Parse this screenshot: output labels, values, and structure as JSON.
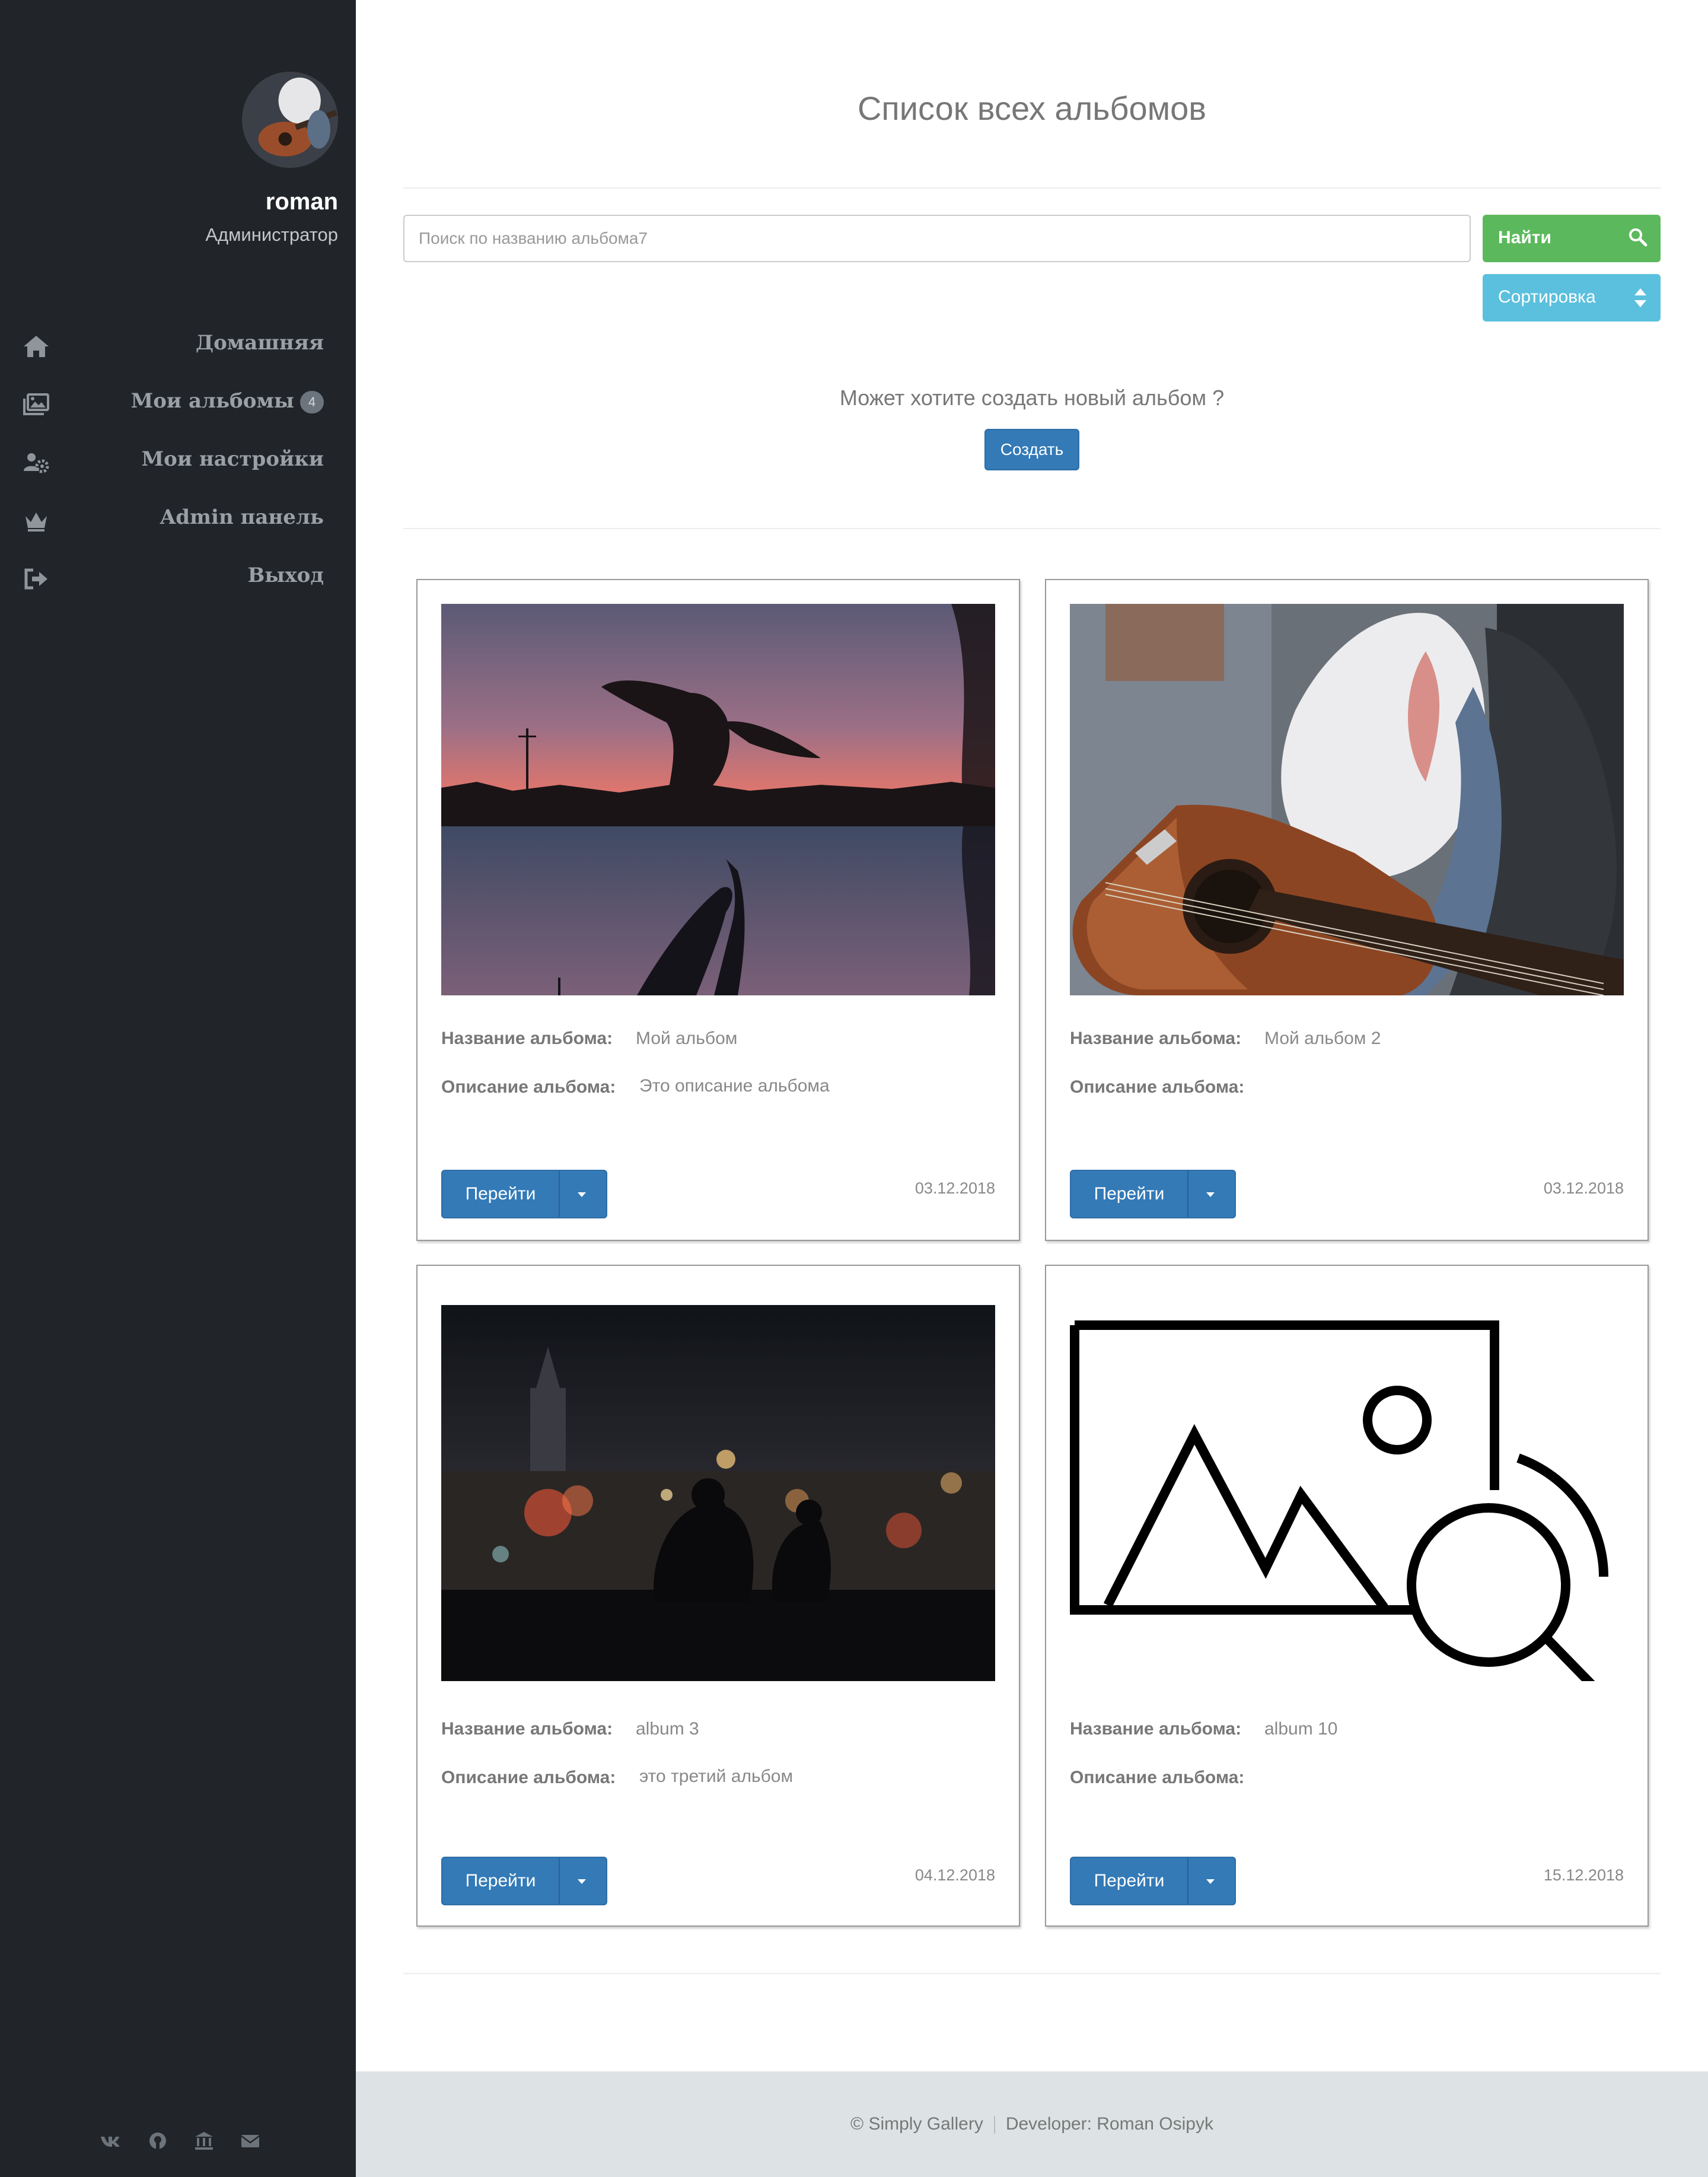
{
  "user": {
    "name": "roman",
    "role": "Администратор"
  },
  "nav": [
    {
      "label": "Домашняя",
      "icon": "home-icon"
    },
    {
      "label": "Мои альбомы",
      "icon": "images-icon",
      "badge": "4"
    },
    {
      "label": "Мои настройки",
      "icon": "users-gear-icon"
    },
    {
      "label": "Admin панель",
      "icon": "crown-icon"
    },
    {
      "label": "Выход",
      "icon": "sign-out-icon"
    }
  ],
  "social": [
    "vk-icon",
    "github-icon",
    "bank-icon",
    "envelope-icon"
  ],
  "page_title": "Список всех альбомов",
  "search": {
    "placeholder": "Поиск по названию альбома7",
    "value": ""
  },
  "find_label": "Найти",
  "sort_label": "Сортировка",
  "create_prompt": "Может хотите создать новый альбом ?",
  "create_label": "Создать",
  "labels": {
    "name": "Название альбома:",
    "desc": "Описание альбома:",
    "go": "Перейти"
  },
  "albums": [
    {
      "name": "Мой альбом",
      "desc": "Это описание альбома",
      "date": "03.12.2018",
      "image": "sunset-silhouette"
    },
    {
      "name": "Мой альбом 2",
      "desc": "",
      "date": "03.12.2018",
      "image": "guitar-shark"
    },
    {
      "name": "album 3",
      "desc": "это третий альбом",
      "date": "04.12.2018",
      "image": "night-city-couple"
    },
    {
      "name": "album 10",
      "desc": "",
      "date": "15.12.2018",
      "image": "image-search-placeholder-icon"
    }
  ],
  "footer": {
    "copyright": "© Simply Gallery",
    "developer": "Developer: Roman Osipyk"
  },
  "colors": {
    "sidebar": "#212529",
    "success": "#5cb85c",
    "info": "#5bc0de",
    "primary": "#337ab7",
    "footer": "#dde3e4"
  }
}
